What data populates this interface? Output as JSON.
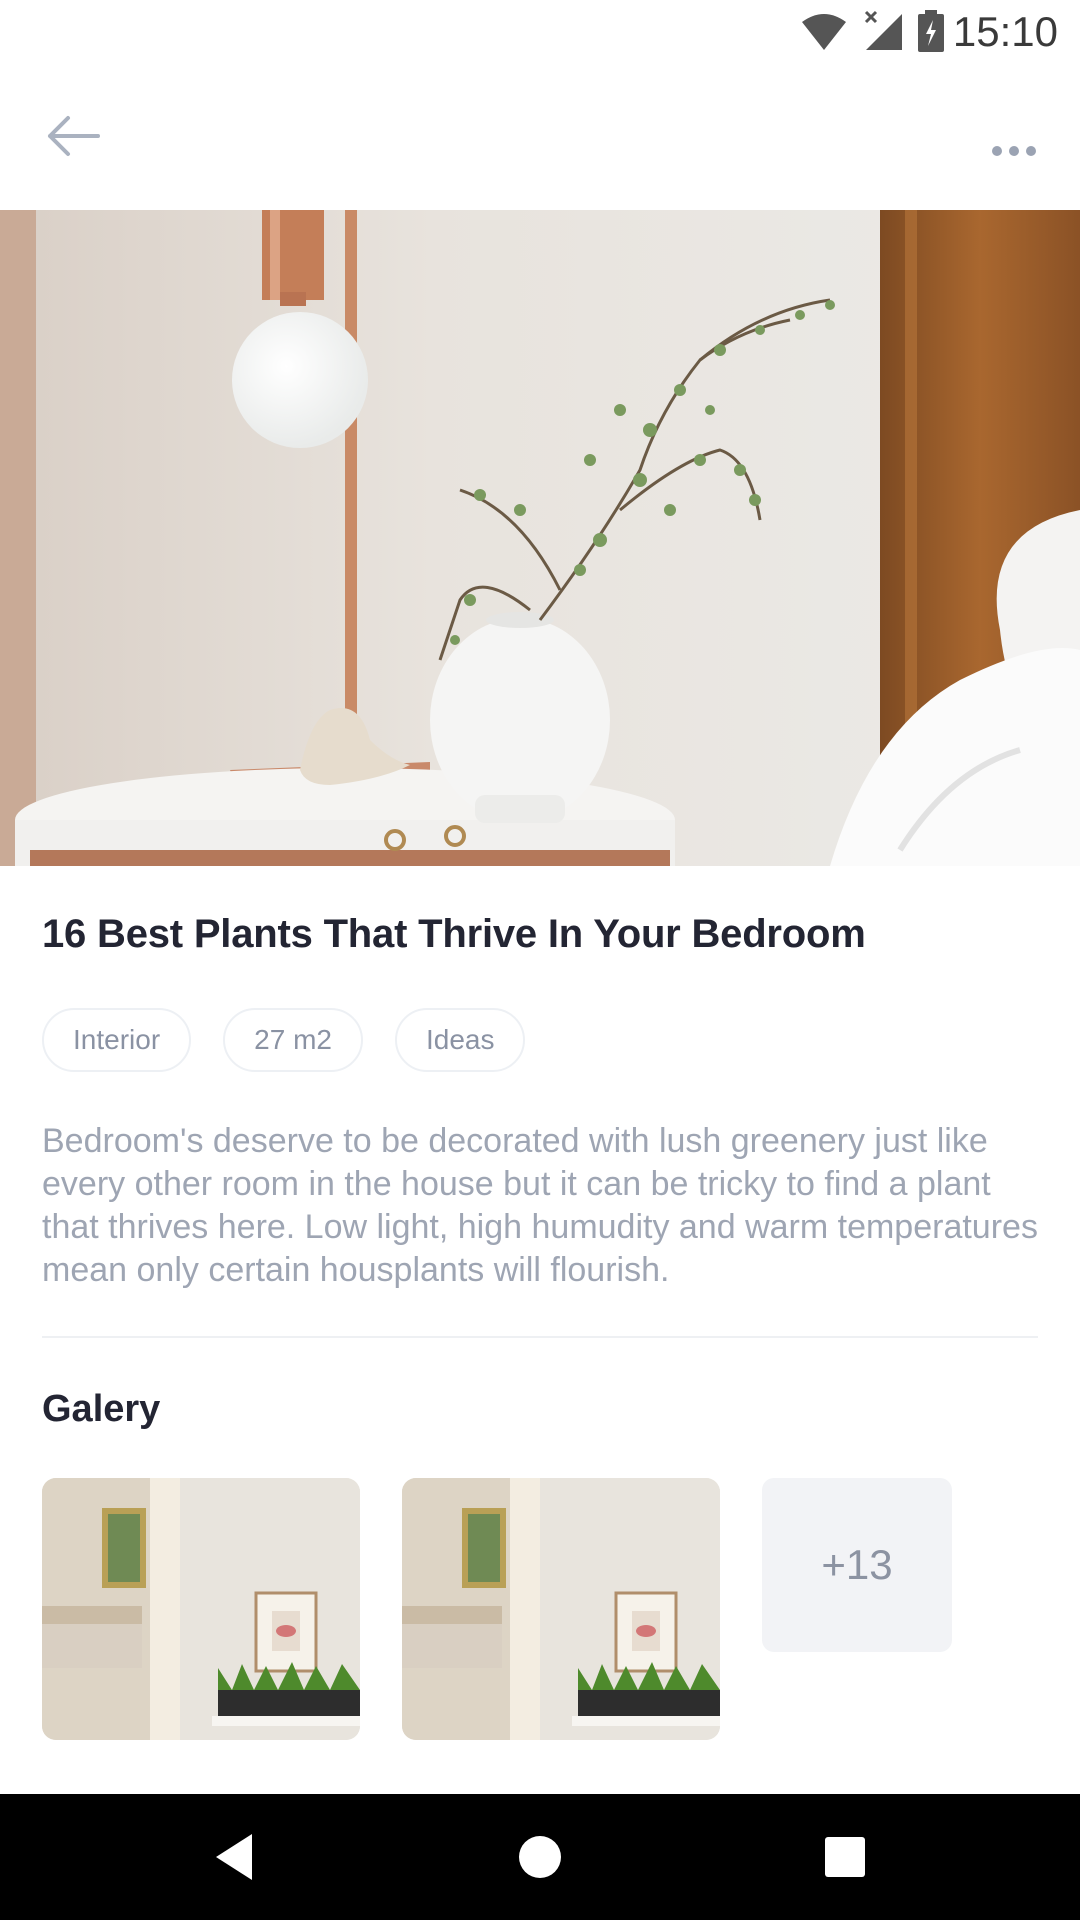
{
  "status_bar": {
    "time": "15:10",
    "icons": [
      "wifi-icon",
      "signal-icon",
      "battery-charging-icon"
    ]
  },
  "app_bar": {
    "back_icon": "arrow-left-icon",
    "more_icon": "more-horizontal-icon"
  },
  "article": {
    "title": "16 Best Plants That Thrive In Your Bedroom",
    "tags": [
      "Interior",
      "27 m2",
      "Ideas"
    ],
    "description": "Bedroom's deserve to be decorated with lush greenery just like every other room in the house but it can be tricky to find a plant that thrives here. Low light, high humudity and warm temperatures mean only certain housplants will flourish."
  },
  "gallery": {
    "title": "Galery",
    "more_count": "+13"
  },
  "nav_bar": {
    "icons": [
      "nav-back-icon",
      "nav-home-icon",
      "nav-recent-icon"
    ]
  },
  "colors": {
    "title": "#232533",
    "body_text": "#9ea5b3",
    "tag_border": "#edf0f4",
    "icon_gray": "#9ba3b3"
  }
}
